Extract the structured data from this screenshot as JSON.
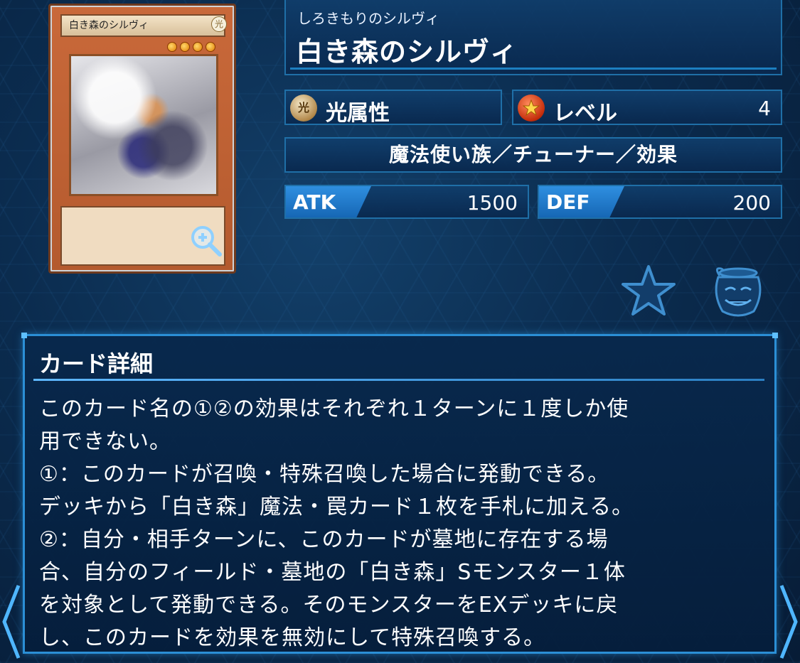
{
  "card": {
    "image_name": "白き森のシルヴィ",
    "attribute_glyph": "光",
    "image_stars": 4
  },
  "header": {
    "ruby": "しろきもりのシルヴィ",
    "title": "白き森のシルヴィ"
  },
  "attribute": {
    "label": "光属性",
    "icon_glyph": "光"
  },
  "level": {
    "label": "レベル",
    "value": "4"
  },
  "type_line": "魔法使い族／チューナー／効果",
  "stats": {
    "atk_label": "ATK",
    "atk_value": "1500",
    "def_label": "DEF",
    "def_value": "200"
  },
  "actions": {
    "favorite_icon": "star-icon",
    "deck_icon": "pot-icon"
  },
  "detail": {
    "title": "カード詳細",
    "text": "このカード名の①②の効果はそれぞれ１ターンに１度しか使\n用できない。\n①：このカードが召喚・特殊召喚した場合に発動できる。\nデッキから「白き森」魔法・罠カード１枚を手札に加える。\n②：自分・相手ターンに、このカードが墓地に存在する場\n合、自分のフィールド・墓地の「白き森」Sモンスター１体\nを対象として発動できる。そのモンスターをEXデッキに戻\nし、このカードを効果を無効にして特殊召喚する。"
  },
  "colors": {
    "background": "#0b2c4f",
    "panel_border": "#1f6fa7",
    "stat_tag": "#2f8fe0",
    "detail_border": "#2b8fd6"
  }
}
